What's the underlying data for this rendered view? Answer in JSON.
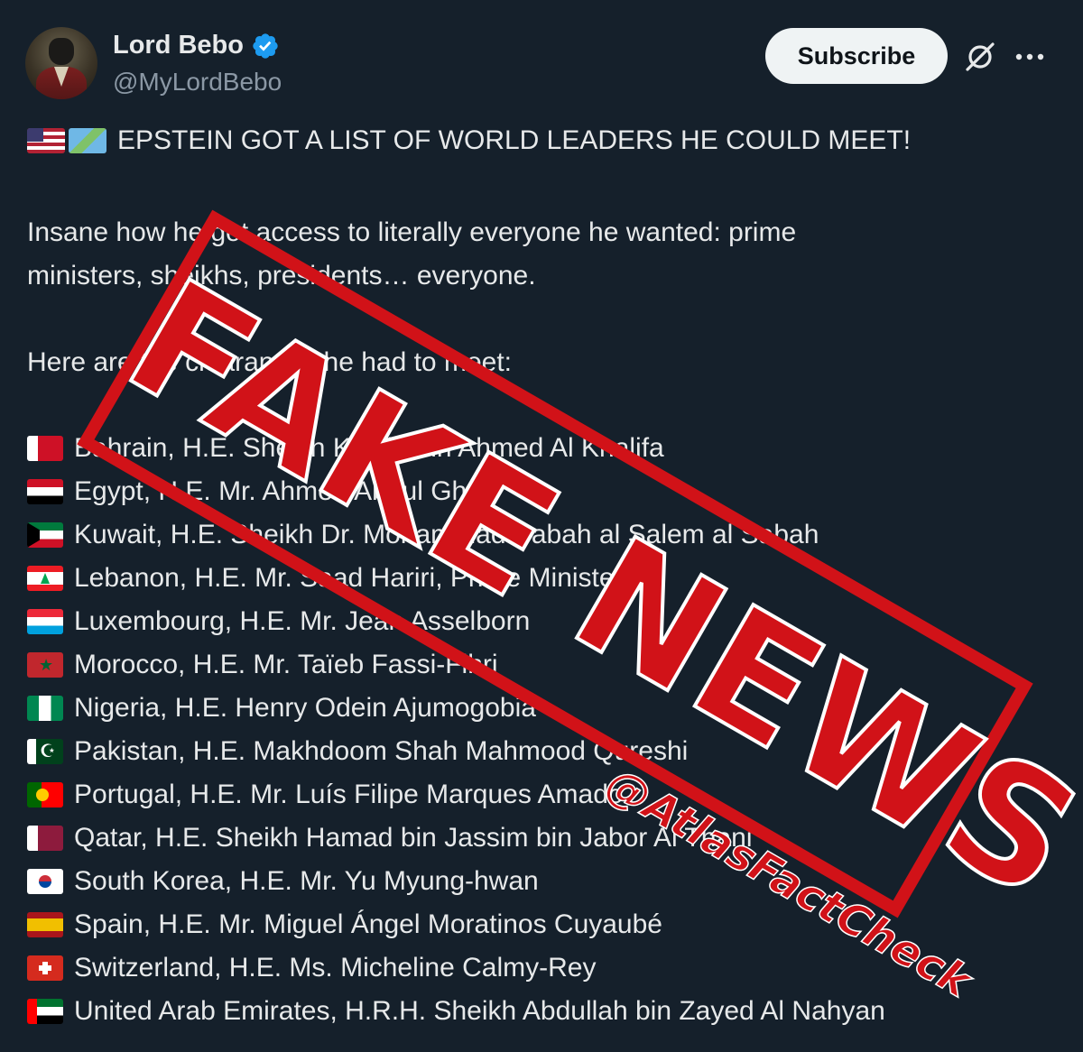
{
  "author": {
    "display_name": "Lord Bebo",
    "handle": "@MyLordBebo",
    "verified": true,
    "avatar": "portrait-avatar"
  },
  "actions": {
    "subscribe_label": "Subscribe",
    "grok_icon": "grok-icon",
    "more_icon": "more-icon"
  },
  "post": {
    "headline_emojis": [
      "us-flag",
      "world-map"
    ],
    "headline": "EPSTEIN GOT A LIST OF WORLD LEADERS HE COULD MEET!",
    "para1_line1": "Insane how he got access to literally everyone he wanted: prime",
    "para1_line2": "ministers, sheikhs, presidents… everyone.",
    "para2": "Here are the clearances he had to meet:",
    "list": [
      {
        "flag": "bahrain",
        "text": "Bahrain, H.E. Sheikh Khalid bin Ahmed Al Khalifa"
      },
      {
        "flag": "egypt",
        "text": "Egypt, H.E. Mr. Ahmed Aboul Gheit"
      },
      {
        "flag": "kuwait",
        "text": "Kuwait, H.E. Sheikh Dr. Mohammad Sabah al Salem al Sabah"
      },
      {
        "flag": "lebanon",
        "text": "Lebanon, H.E. Mr. Saad Hariri, Prime Minister"
      },
      {
        "flag": "luxembourg",
        "text": "Luxembourg, H.E. Mr. Jean Asselborn"
      },
      {
        "flag": "morocco",
        "text": "Morocco, H.E. Mr. Taïeb Fassi-Fihri"
      },
      {
        "flag": "nigeria",
        "text": "Nigeria, H.E. Henry Odein Ajumogobia"
      },
      {
        "flag": "pakistan",
        "text": "Pakistan, H.E. Makhdoom Shah Mahmood Qureshi"
      },
      {
        "flag": "portugal",
        "text": "Portugal, H.E. Mr. Luís Filipe Marques Amado"
      },
      {
        "flag": "qatar",
        "text": "Qatar, H.E. Sheikh Hamad bin Jassim bin Jabor Al Thani"
      },
      {
        "flag": "south-korea",
        "text": "South Korea, H.E. Mr. Yu Myung-hwan"
      },
      {
        "flag": "spain",
        "text": "Spain, H.E. Mr. Miguel Ángel Moratinos Cuyaubé"
      },
      {
        "flag": "switzerland",
        "text": "Switzerland, H.E. Ms. Micheline Calmy-Rey"
      },
      {
        "flag": "uae",
        "text": "United Arab Emirates, H.R.H. Sheikh Abdullah bin Zayed Al Nahyan"
      }
    ]
  },
  "overlay": {
    "stamp_text": "FAKE NEWS",
    "watermark": "@AtlasFactCheck",
    "stamp_color": "#d11218"
  },
  "colors": {
    "background": "#15202b",
    "text": "#e7e9ea",
    "muted": "#8b98a5",
    "verified": "#1d9bf0"
  }
}
